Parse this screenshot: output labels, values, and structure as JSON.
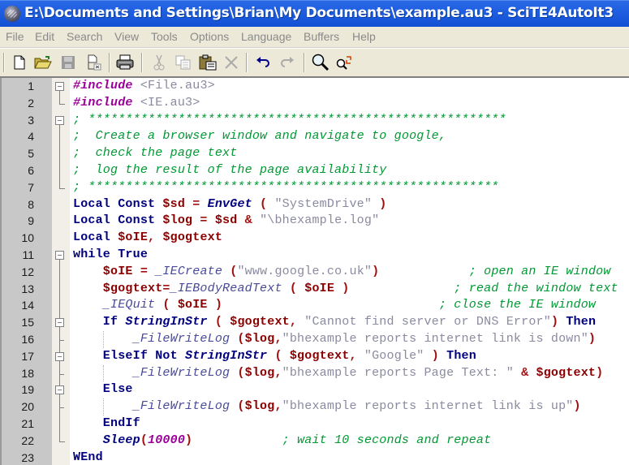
{
  "window": {
    "title": "E:\\Documents and Settings\\Brian\\My Documents\\example.au3 - SciTE4AutoIt3",
    "app_icon": "scite-globe-icon"
  },
  "menu": [
    "File",
    "Edit",
    "Search",
    "View",
    "Tools",
    "Options",
    "Language",
    "Buffers",
    "Help"
  ],
  "toolbar": {
    "buttons": [
      {
        "name": "new-file",
        "icon": "new-document-icon",
        "enabled": true
      },
      {
        "name": "open-file",
        "icon": "open-folder-icon",
        "enabled": true
      },
      {
        "name": "save-file",
        "icon": "save-disk-icon",
        "enabled": false
      },
      {
        "name": "close-file",
        "icon": "close-document-icon",
        "enabled": true
      },
      {
        "name": "print",
        "icon": "printer-icon",
        "enabled": true
      },
      {
        "name": "cut",
        "icon": "scissors-icon",
        "enabled": false
      },
      {
        "name": "copy",
        "icon": "copy-icon",
        "enabled": false
      },
      {
        "name": "paste",
        "icon": "paste-icon",
        "enabled": true
      },
      {
        "name": "delete",
        "icon": "delete-x-icon",
        "enabled": false
      },
      {
        "name": "undo",
        "icon": "undo-arrow-icon",
        "enabled": true
      },
      {
        "name": "redo",
        "icon": "redo-arrow-icon",
        "enabled": false
      },
      {
        "name": "find",
        "icon": "magnifier-icon",
        "enabled": true
      },
      {
        "name": "replace",
        "icon": "find-replace-icon",
        "enabled": true
      }
    ]
  },
  "editor": {
    "lines": [
      {
        "n": "1",
        "tokens": [
          [
            "pp",
            "#include"
          ],
          [
            "inc",
            " <File.au3>"
          ]
        ]
      },
      {
        "n": "2",
        "tokens": [
          [
            "pp",
            "#include"
          ],
          [
            "inc",
            " <IE.au3>"
          ]
        ]
      },
      {
        "n": "3",
        "tokens": [
          [
            "c",
            "; ********************************************************"
          ]
        ]
      },
      {
        "n": "4",
        "tokens": [
          [
            "c",
            ";  Create a browser window and navigate to google,"
          ]
        ]
      },
      {
        "n": "5",
        "tokens": [
          [
            "c",
            ";  check the page text"
          ]
        ]
      },
      {
        "n": "6",
        "tokens": [
          [
            "c",
            ";  log the result of the page availability"
          ]
        ]
      },
      {
        "n": "7",
        "tokens": [
          [
            "c",
            "; *******************************************************"
          ]
        ]
      },
      {
        "n": "8",
        "tokens": [
          [
            "kw",
            "Local Const "
          ],
          [
            "v",
            "$sd"
          ],
          [
            "op",
            " = "
          ],
          [
            "fn",
            "EnvGet"
          ],
          [
            "op",
            " ( "
          ],
          [
            "s",
            "\"SystemDrive\""
          ],
          [
            "op",
            " )"
          ]
        ]
      },
      {
        "n": "9",
        "tokens": [
          [
            "kw",
            "Local Const "
          ],
          [
            "v",
            "$log"
          ],
          [
            "op",
            " = "
          ],
          [
            "v",
            "$sd"
          ],
          [
            "op",
            " & "
          ],
          [
            "s",
            "\"\\bhexample.log\""
          ]
        ]
      },
      {
        "n": "10",
        "tokens": [
          [
            "kw",
            "Local "
          ],
          [
            "v",
            "$oIE"
          ],
          [
            "op",
            ", "
          ],
          [
            "v",
            "$gogtext"
          ]
        ]
      },
      {
        "n": "11",
        "tokens": [
          [
            "kw",
            "while True"
          ]
        ]
      },
      {
        "n": "12",
        "tokens": [
          [
            "v",
            "    $oIE"
          ],
          [
            "op",
            " = "
          ],
          [
            "udf",
            "_IECreate"
          ],
          [
            "op",
            " ("
          ],
          [
            "s",
            "\"www.google.co.uk\""
          ],
          [
            "op",
            ")"
          ],
          [
            "c",
            "            ; open an IE window"
          ]
        ]
      },
      {
        "n": "13",
        "tokens": [
          [
            "v",
            "    $gogtext"
          ],
          [
            "op",
            "="
          ],
          [
            "udf",
            "_IEBodyReadText"
          ],
          [
            "op",
            " ( "
          ],
          [
            "v",
            "$oIE"
          ],
          [
            "op",
            " )"
          ],
          [
            "c",
            "              ; read the window text"
          ]
        ]
      },
      {
        "n": "14",
        "tokens": [
          [
            "udf",
            "    _IEQuit"
          ],
          [
            "op",
            " ( "
          ],
          [
            "v",
            "$oIE"
          ],
          [
            "op",
            " )"
          ],
          [
            "c",
            "                             ; close the IE window"
          ]
        ]
      },
      {
        "n": "15",
        "tokens": [
          [
            "kw",
            "    If "
          ],
          [
            "fn",
            "StringInStr"
          ],
          [
            "op",
            " ( "
          ],
          [
            "v",
            "$gogtext"
          ],
          [
            "op",
            ", "
          ],
          [
            "s",
            "\"Cannot find server or DNS Error\""
          ],
          [
            "op",
            ") "
          ],
          [
            "kw",
            "Then"
          ]
        ]
      },
      {
        "n": "16",
        "tokens": [
          [
            "udf",
            "        _FileWriteLog"
          ],
          [
            "op",
            " ("
          ],
          [
            "v",
            "$log"
          ],
          [
            "op",
            ","
          ],
          [
            "s",
            "\"bhexample reports internet link is down\""
          ],
          [
            "op",
            ")"
          ]
        ]
      },
      {
        "n": "17",
        "tokens": [
          [
            "kw",
            "    ElseIf Not "
          ],
          [
            "fn",
            "StringInStr"
          ],
          [
            "op",
            " ( "
          ],
          [
            "v",
            "$gogtext"
          ],
          [
            "op",
            ", "
          ],
          [
            "s",
            "\"Google\""
          ],
          [
            "op",
            " ) "
          ],
          [
            "kw",
            "Then"
          ]
        ]
      },
      {
        "n": "18",
        "tokens": [
          [
            "udf",
            "        _FileWriteLog"
          ],
          [
            "op",
            " ("
          ],
          [
            "v",
            "$log"
          ],
          [
            "op",
            ","
          ],
          [
            "s",
            "\"bhexample reports Page Text: \""
          ],
          [
            "op",
            " & "
          ],
          [
            "v",
            "$gogtext"
          ],
          [
            "op",
            ")"
          ]
        ]
      },
      {
        "n": "19",
        "tokens": [
          [
            "kw",
            "    Else"
          ]
        ]
      },
      {
        "n": "20",
        "tokens": [
          [
            "udf",
            "        _FileWriteLog"
          ],
          [
            "op",
            " ("
          ],
          [
            "v",
            "$log"
          ],
          [
            "op",
            ","
          ],
          [
            "s",
            "\"bhexample reports internet link is up\""
          ],
          [
            "op",
            ")"
          ]
        ]
      },
      {
        "n": "21",
        "tokens": [
          [
            "kw",
            "    EndIf"
          ]
        ]
      },
      {
        "n": "22",
        "tokens": [
          [
            "fn",
            "    Sleep"
          ],
          [
            "op",
            "("
          ],
          [
            "num",
            "10000"
          ],
          [
            "op",
            ")"
          ],
          [
            "c",
            "            ; wait 10 seconds and repeat"
          ]
        ]
      },
      {
        "n": "23",
        "tokens": [
          [
            "kw",
            "WEnd"
          ]
        ]
      }
    ]
  },
  "colors": {
    "titlebar": "#1f5ee0",
    "keyword": "#00007f",
    "variable": "#8b0000",
    "string": "#8a8aa0",
    "comment": "#009933",
    "preprocessor": "#9a009a"
  }
}
